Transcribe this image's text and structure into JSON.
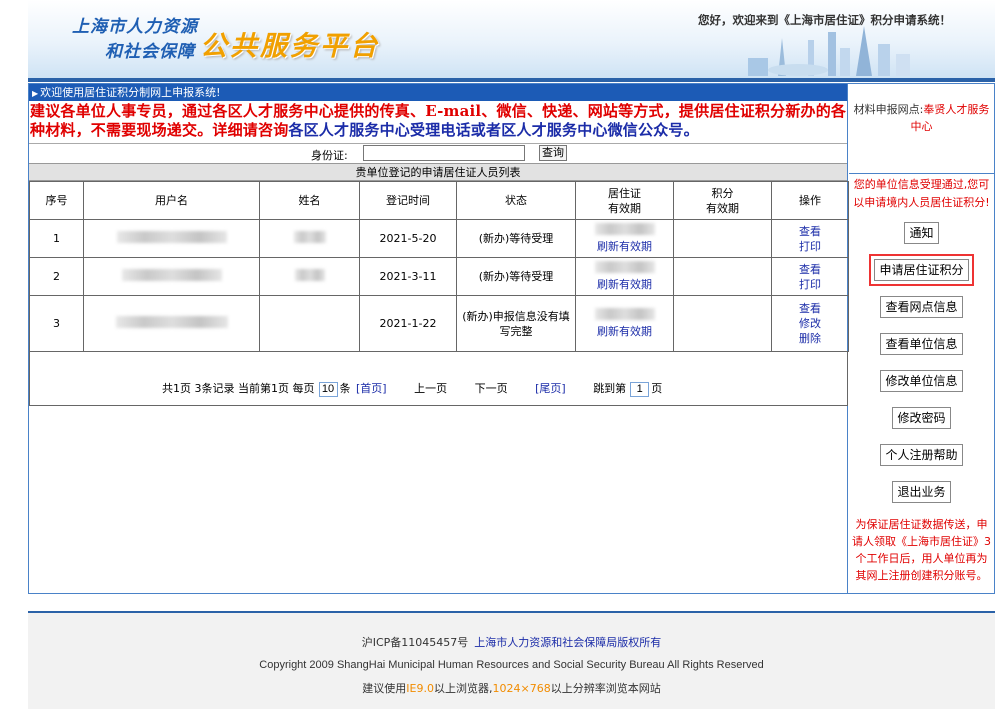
{
  "header": {
    "logo_line1": "上海市人力资源",
    "logo_line2": "和社会保障",
    "logo_big": "公共服务平台",
    "welcome": "您好，欢迎来到《上海市居住证》积分申请系统！"
  },
  "notice_bar": "欢迎使用居住证积分制网上申报系统!",
  "big_notice": {
    "red_part": "建议各单位人事专员，通过各区人才服务中心提供的传真、E-mail、微信、快递、网站等方式，提供居住证积分新办的各种材料，不需要现场递交。详细请咨询",
    "blue_part": "各区人才服务中心受理电话或者区人才服务中心微信公众号。"
  },
  "search": {
    "label": "身份证:",
    "value": "",
    "button": "查询"
  },
  "list_title": "贵单位登记的申请居住证人员列表",
  "table": {
    "headers": [
      "序号",
      "用户名",
      "姓名",
      "登记时间",
      "状态",
      "居住证\n有效期",
      "积分\n有效期",
      "操作"
    ],
    "rows": [
      {
        "index": "1",
        "date": "2021-5-20",
        "status": "(新办)等待受理",
        "refresh": "刷新有效期",
        "actions": [
          "查看",
          "打印"
        ]
      },
      {
        "index": "2",
        "date": "2021-3-11",
        "status": "(新办)等待受理",
        "refresh": "刷新有效期",
        "actions": [
          "查看",
          "打印"
        ]
      },
      {
        "index": "3",
        "date": "2021-1-22",
        "status": "(新办)申报信息没有填写完整",
        "refresh": "刷新有效期",
        "actions": [
          "查看",
          "修改",
          "删除"
        ]
      }
    ]
  },
  "pager": {
    "summary": "共1页 3条记录 当前第1页 每页",
    "per_page": "10",
    "per_page_suffix": "条",
    "first": "[首页]",
    "prev": "上一页",
    "next": "下一页",
    "last": "[尾页]",
    "jump_label": "跳到第",
    "jump_value": "1",
    "jump_suffix": "页"
  },
  "sidebar": {
    "site_label": "材料申报网点:",
    "site_value": "奉贤人才服务中心",
    "message": "您的单位信息受理通过,您可以申请境内人员居住证积分!",
    "buttons": [
      "通知",
      "申请居住证积分",
      "查看网点信息",
      "查看单位信息",
      "修改单位信息",
      "修改密码",
      "个人注册帮助",
      "退出业务"
    ],
    "selected_index": 1,
    "bottom_note": "为保证居住证数据传送，申请人领取《上海市居住证》3个工作日后，用人单位再为其网上注册创建积分账号。"
  },
  "footer": {
    "icp": "沪ICP备11045457号",
    "owner": "上海市人力资源和社会保障局版权所有",
    "copyright": "Copyright 2009 ShangHai Municipal Human Resources and Social Security Bureau All Rights Reserved",
    "browser_pre": "建议使用",
    "browser_ie": "IE9.0",
    "browser_mid": "以上浏览器,",
    "browser_res": "1024×768",
    "browser_post": "以上分辨率浏览本网站"
  },
  "colors": {
    "accent_blue": "#1c5bb6",
    "notice_red": "#e00000",
    "link_blue": "#1b2ca8",
    "logo_orange": "#f1a000"
  }
}
